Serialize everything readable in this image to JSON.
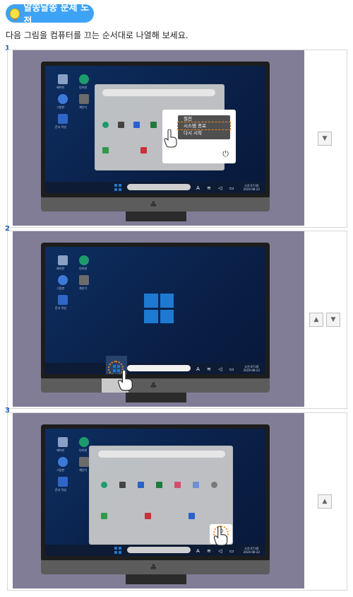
{
  "badge": {
    "title": "알쏭달쏭 문제 도전"
  },
  "instruction": "다음 그림을 컴퓨터를 끄는 순서대로 나열해 보세요.",
  "items": [
    {
      "number": "1",
      "arrows": [
        "▼"
      ]
    },
    {
      "number": "2",
      "arrows": [
        "▲",
        "▼"
      ]
    },
    {
      "number": "3",
      "arrows": [
        "▲"
      ]
    }
  ],
  "power_menu": {
    "sleep": "절전",
    "shutdown": "시스템 종료",
    "restart": "다시 시작"
  },
  "desktop_icons": [
    "제어판",
    "인터넷",
    "그림판",
    "계산기",
    "문서 작성"
  ],
  "clock": {
    "time": "오전 07:00",
    "date": "2024-08-22"
  }
}
